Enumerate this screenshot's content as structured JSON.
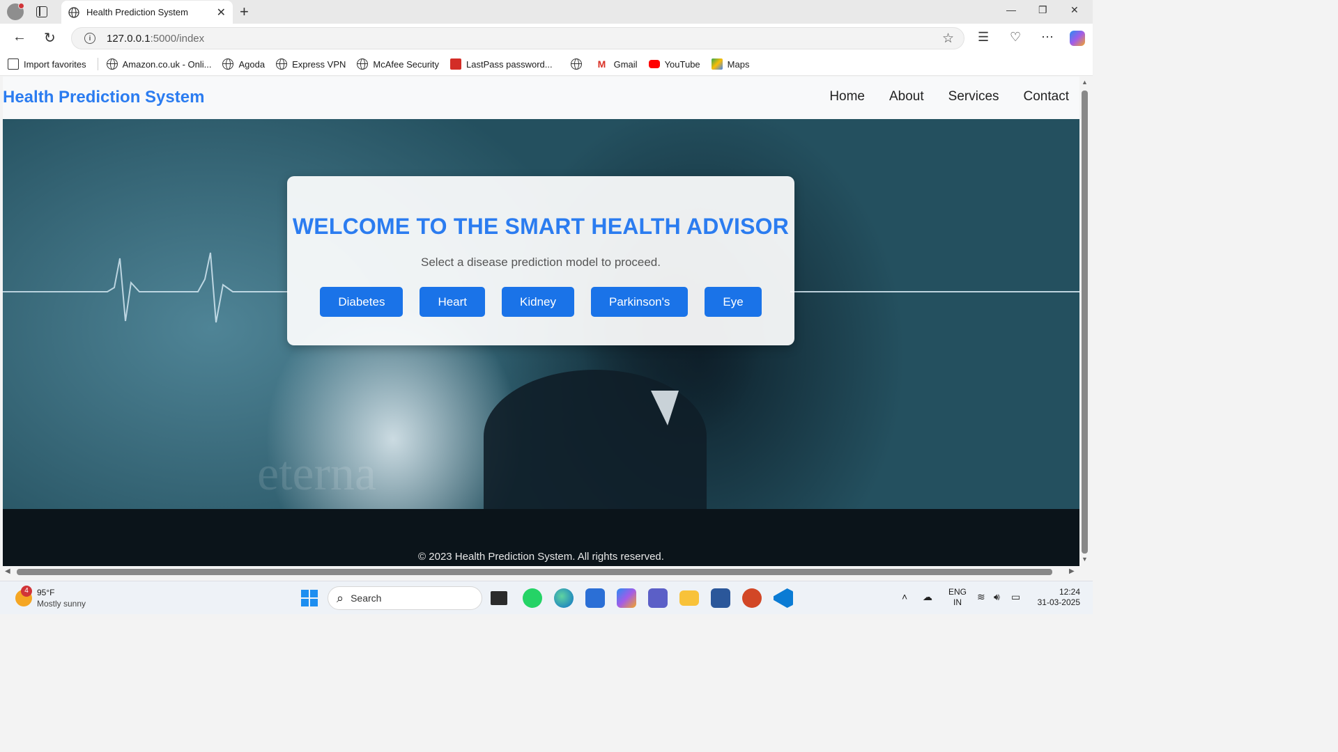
{
  "browser": {
    "tab_title": "Health Prediction System",
    "url_host": "127.0.0.1",
    "url_rest": ":5000/index",
    "favorites": [
      {
        "label": "Import favorites",
        "icon": "import-icon"
      },
      {
        "label": "Amazon.co.uk - Onli...",
        "icon": "globe-icon"
      },
      {
        "label": "Agoda",
        "icon": "globe-icon"
      },
      {
        "label": "Express VPN",
        "icon": "globe-icon"
      },
      {
        "label": "McAfee Security",
        "icon": "globe-icon"
      },
      {
        "label": "LastPass password...",
        "icon": "lastpass-icon"
      },
      {
        "label": "",
        "icon": "globe-icon"
      },
      {
        "label": "Gmail",
        "icon": "gmail-icon"
      },
      {
        "label": "YouTube",
        "icon": "youtube-icon"
      },
      {
        "label": "Maps",
        "icon": "maps-icon"
      }
    ]
  },
  "site": {
    "brand": "Health Prediction System",
    "nav": [
      "Home",
      "About",
      "Services",
      "Contact"
    ],
    "hero": {
      "title": "WELCOME TO THE SMART HEALTH ADVISOR",
      "subtitle": "Select a disease prediction model to proceed.",
      "buttons": [
        "Diabetes",
        "Heart",
        "Kidney",
        "Parkinson's",
        "Eye"
      ],
      "watermark": "eterna"
    },
    "footer": "© 2023 Health Prediction System. All rights reserved.",
    "colors": {
      "brand": "#2b7cf0",
      "button": "#1a73e8",
      "footer": "#0b141a"
    }
  },
  "taskbar": {
    "weather_temp": "95°F",
    "weather_desc": "Mostly sunny",
    "weather_badge": "4",
    "search_label": "Search",
    "lang_line1": "ENG",
    "lang_line2": "IN",
    "time": "12:24",
    "date": "31-03-2025"
  }
}
